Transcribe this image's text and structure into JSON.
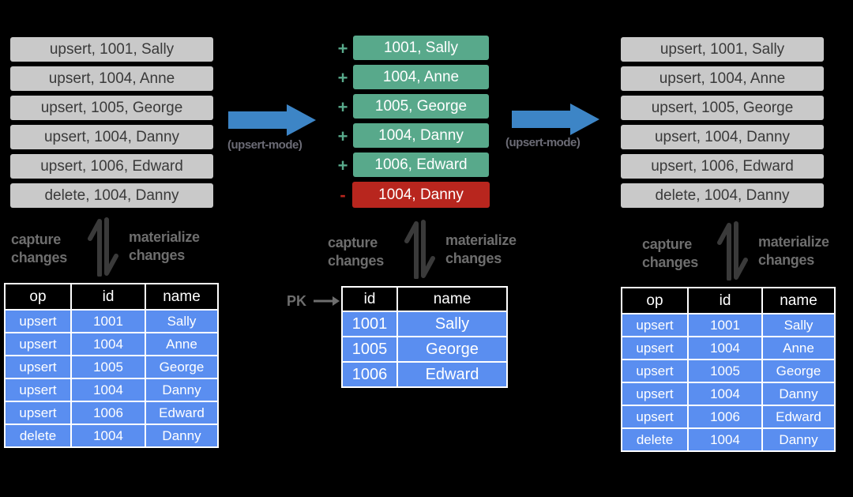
{
  "left_stream": {
    "items": [
      "upsert, 1001, Sally",
      "upsert, 1004, Anne",
      "upsert, 1005, George",
      "upsert, 1004, Danny",
      "upsert, 1006, Edward",
      "delete, 1004, Danny"
    ]
  },
  "arrow_1": {
    "label": "(upsert-mode)",
    "color": "#3d85c6"
  },
  "middle_changelog": {
    "items": [
      {
        "sign": "+",
        "text": "1001, Sally",
        "kind": "insert"
      },
      {
        "sign": "+",
        "text": "1004, Anne",
        "kind": "insert"
      },
      {
        "sign": "+",
        "text": "1005, George",
        "kind": "insert"
      },
      {
        "sign": "+",
        "text": "1004, Danny",
        "kind": "insert"
      },
      {
        "sign": "+",
        "text": "1006, Edward",
        "kind": "insert"
      },
      {
        "sign": "-",
        "text": "1004, Danny",
        "kind": "delete"
      }
    ],
    "colors": {
      "insert": "#58a98b",
      "delete": "#b8261e"
    }
  },
  "arrow_2": {
    "label": "(upsert-mode)",
    "color": "#3d85c6"
  },
  "right_stream": {
    "items": [
      "upsert, 1001, Sally",
      "upsert, 1004, Anne",
      "upsert, 1005, George",
      "upsert, 1004, Danny",
      "upsert, 1006, Edward",
      "delete, 1004, Danny"
    ]
  },
  "captions": {
    "capture": [
      "capture",
      "changes"
    ],
    "materialize": [
      "materialize",
      "changes"
    ]
  },
  "left_table": {
    "headers": [
      "op",
      "id",
      "name"
    ],
    "rows": [
      [
        "upsert",
        "1001",
        "Sally"
      ],
      [
        "upsert",
        "1004",
        "Anne"
      ],
      [
        "upsert",
        "1005",
        "George"
      ],
      [
        "upsert",
        "1004",
        "Danny"
      ],
      [
        "upsert",
        "1006",
        "Edward"
      ],
      [
        "delete",
        "1004",
        "Danny"
      ]
    ]
  },
  "middle_table": {
    "pk_label": "PK",
    "headers": [
      "id",
      "name"
    ],
    "rows": [
      [
        "1001",
        "Sally"
      ],
      [
        "1005",
        "George"
      ],
      [
        "1006",
        "Edward"
      ]
    ]
  },
  "right_table": {
    "headers": [
      "op",
      "id",
      "name"
    ],
    "rows": [
      [
        "upsert",
        "1001",
        "Sally"
      ],
      [
        "upsert",
        "1004",
        "Anne"
      ],
      [
        "upsert",
        "1005",
        "George"
      ],
      [
        "upsert",
        "1004",
        "Danny"
      ],
      [
        "upsert",
        "1006",
        "Edward"
      ],
      [
        "delete",
        "1004",
        "Danny"
      ]
    ]
  }
}
